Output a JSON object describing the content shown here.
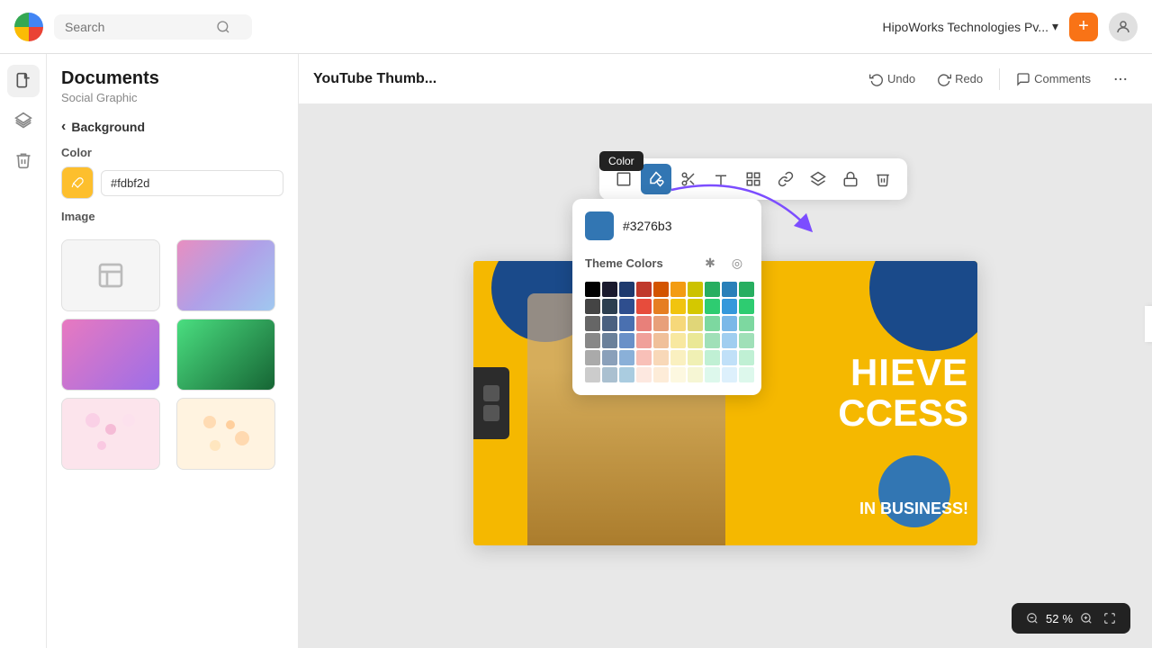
{
  "topbar": {
    "search_placeholder": "Search",
    "company": "HipoWorks Technologies Pv...",
    "add_label": "+",
    "chevron": "▾"
  },
  "sidebar": {
    "title": "Documents",
    "subtitle": "Social Graphic",
    "back_label": "Background",
    "color_label": "Color",
    "color_hex": "#fdbf2d",
    "image_label": "Image"
  },
  "canvas": {
    "title": "YouTube Thumb...",
    "undo_label": "Undo",
    "redo_label": "Redo",
    "comments_label": "Comments"
  },
  "color_popup": {
    "tooltip": "Color",
    "hex_value": "#3276b3",
    "theme_label": "Theme Colors"
  },
  "zoom": {
    "value": "52",
    "percent": "%"
  },
  "palette": {
    "row1": [
      "#000000",
      "#1a1a2e",
      "#1e3a6e",
      "#c0392b",
      "#d35400",
      "#f39c12",
      "#ccc200",
      "#27ae60",
      "#2980b9",
      "#27ae60"
    ],
    "row2": [
      "#444444",
      "#2c3e50",
      "#2e4e8e",
      "#e74c3c",
      "#e67e22",
      "#f1c40f",
      "#d4c800",
      "#2ecc71",
      "#3498db",
      "#2ecc71"
    ],
    "row3": [
      "#666666",
      "#4a6080",
      "#4a70b0",
      "#e8807a",
      "#e8a07a",
      "#f6d87a",
      "#e0d678",
      "#7dd8a0",
      "#7ab8e8",
      "#7dd8a0"
    ],
    "row4": [
      "#888888",
      "#6a809a",
      "#6a90c8",
      "#f0a09a",
      "#f0c09a",
      "#f8e8a0",
      "#eae896",
      "#a0e0b8",
      "#a0cef0",
      "#a0e0b8"
    ],
    "row5": [
      "#aaaaaa",
      "#8aa0ba",
      "#8ab0d8",
      "#f8c0b8",
      "#f8d8b8",
      "#faf0c0",
      "#f0f0b4",
      "#c0f0d4",
      "#c0e0f8",
      "#c0f0d4"
    ],
    "row6": [
      "#cccccc",
      "#aac0d0",
      "#aacce0",
      "#fde8e0",
      "#fdecd8",
      "#fdf8e0",
      "#f6f6d4",
      "#ddf8ec",
      "#ddf0fc",
      "#ddf8ec"
    ]
  }
}
